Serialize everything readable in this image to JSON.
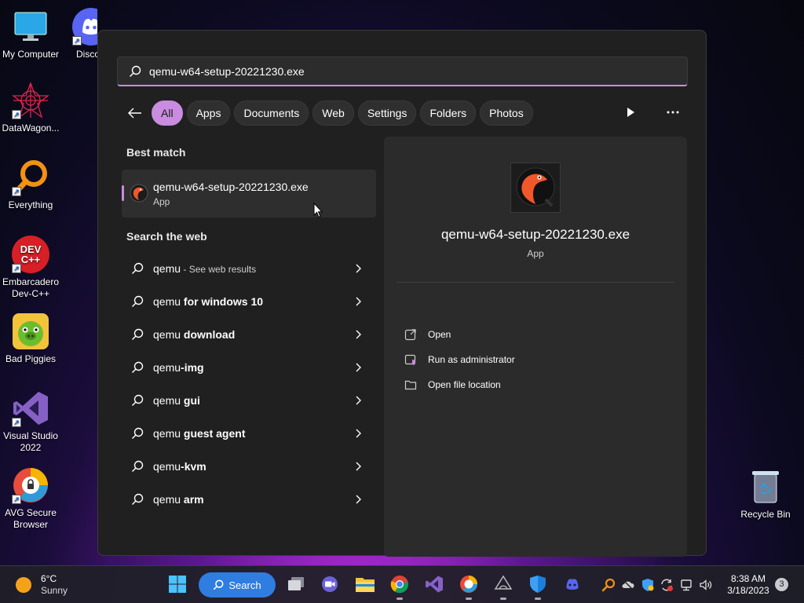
{
  "desktop": {
    "icons": [
      {
        "label": "My Computer"
      },
      {
        "label": "Disco"
      },
      {
        "label": "DataWagon..."
      },
      {
        "label": "Everything"
      },
      {
        "label": "Embarcadero Dev-C++"
      },
      {
        "label": "Bad Piggies"
      },
      {
        "label": "Visual Studio 2022"
      },
      {
        "label": "AVG Secure Browser"
      },
      {
        "label": "Recycle Bin"
      }
    ],
    "devcpp_logo_text": "DEV C++"
  },
  "search": {
    "query": "qemu-w64-setup-20221230.exe",
    "filters": [
      "All",
      "Apps",
      "Documents",
      "Web",
      "Settings",
      "Folders",
      "Photos"
    ],
    "active_filter": "All"
  },
  "best_match": {
    "title": "Best match",
    "name": "qemu-w64-setup-20221230.exe",
    "type": "App"
  },
  "web": {
    "title": "Search the web",
    "items": [
      {
        "prefix": "qemu",
        "rest": "",
        "hint": " - See web results"
      },
      {
        "prefix": "qemu ",
        "rest": "for windows 10",
        "hint": ""
      },
      {
        "prefix": "qemu ",
        "rest": "download",
        "hint": ""
      },
      {
        "prefix": "qemu",
        "rest": "-img",
        "hint": ""
      },
      {
        "prefix": "qemu ",
        "rest": "gui",
        "hint": ""
      },
      {
        "prefix": "qemu ",
        "rest": "guest agent",
        "hint": ""
      },
      {
        "prefix": "qemu",
        "rest": "-kvm",
        "hint": ""
      },
      {
        "prefix": "qemu ",
        "rest": "arm",
        "hint": ""
      }
    ]
  },
  "detail": {
    "name": "qemu-w64-setup-20221230.exe",
    "type": "App",
    "actions": [
      "Open",
      "Run as administrator",
      "Open file location"
    ]
  },
  "taskbar": {
    "weather_temp": "6°C",
    "weather_desc": "Sunny",
    "search_label": "Search",
    "time": "8:38 AM",
    "date": "3/18/2023",
    "notifications": "3"
  },
  "colors": {
    "accent": "#c98ce0",
    "panel": "#202020",
    "taskbar_search": "#2f7de0"
  }
}
